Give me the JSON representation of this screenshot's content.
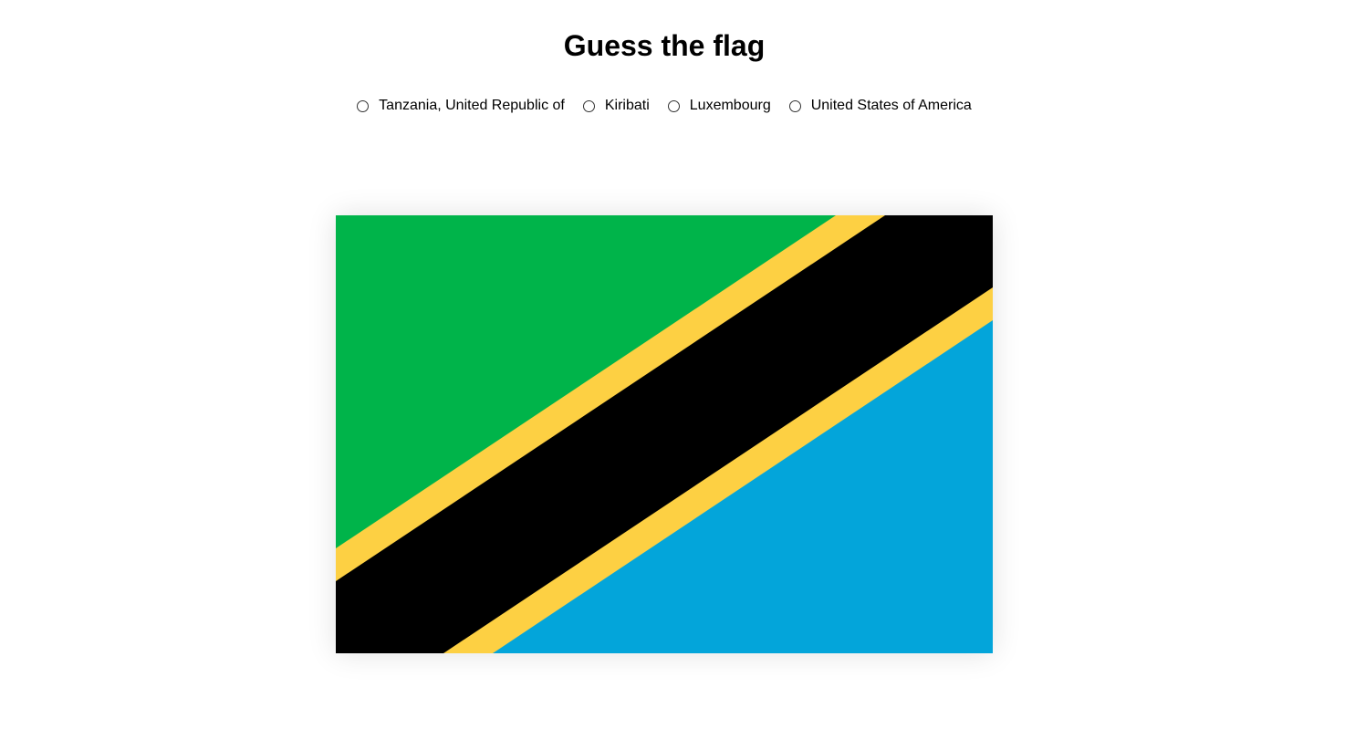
{
  "page": {
    "title": "Guess the flag"
  },
  "options": [
    {
      "label": "Tanzania, United Republic of"
    },
    {
      "label": "Kiribati"
    },
    {
      "label": "Luxembourg"
    },
    {
      "label": "United States of America"
    }
  ],
  "flag": {
    "country_shown": "Tanzania",
    "colors": {
      "green": "#00b44a",
      "yellow": "#fdd043",
      "black": "#000000",
      "blue": "#03a5da"
    }
  }
}
